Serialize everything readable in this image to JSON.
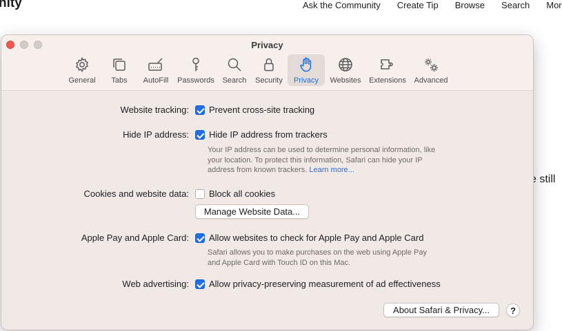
{
  "background_page": {
    "title": "nity",
    "nav": [
      "Ask the Community",
      "Create Tip",
      "Browse",
      "Search",
      "More"
    ],
    "more_chevron": "⌄",
    "body_fragment": "e still"
  },
  "window": {
    "title": "Privacy",
    "toolbar": [
      {
        "label": "General",
        "icon": "gear-icon"
      },
      {
        "label": "Tabs",
        "icon": "tabs-icon"
      },
      {
        "label": "AutoFill",
        "icon": "autofill-icon"
      },
      {
        "label": "Passwords",
        "icon": "key-icon"
      },
      {
        "label": "Search",
        "icon": "search-icon"
      },
      {
        "label": "Security",
        "icon": "lock-icon"
      },
      {
        "label": "Privacy",
        "icon": "hand-icon"
      },
      {
        "label": "Websites",
        "icon": "globe-icon"
      },
      {
        "label": "Extensions",
        "icon": "puzzle-icon"
      },
      {
        "label": "Advanced",
        "icon": "gears-icon"
      }
    ],
    "active_tab": "Privacy",
    "accent": "#1f6fe5"
  },
  "settings": {
    "tracking": {
      "label": "Website tracking:",
      "option": "Prevent cross-site tracking",
      "checked": true
    },
    "hide_ip": {
      "label": "Hide IP address:",
      "option": "Hide IP address from trackers",
      "checked": true,
      "desc_1": "Your IP address can be used to determine personal information, like",
      "desc_2": "your location. To protect this information, Safari can hide your IP",
      "desc_3": "address from known trackers.",
      "learn_more": "Learn more..."
    },
    "cookies": {
      "label": "Cookies and website data:",
      "option": "Block all cookies",
      "checked": false,
      "button": "Manage Website Data..."
    },
    "apple_pay": {
      "label": "Apple Pay and Apple Card:",
      "option": "Allow websites to check for Apple Pay and Apple Card",
      "checked": true,
      "desc_1": "Safari allows you to make purchases on the web using Apple Pay",
      "desc_2": "and Apple Card with Touch ID on this Mac."
    },
    "advertising": {
      "label": "Web advertising:",
      "option": "Allow privacy-preserving measurement of ad effectiveness",
      "checked": true
    }
  },
  "footer": {
    "about_button": "About Safari & Privacy...",
    "help_button": "?"
  }
}
